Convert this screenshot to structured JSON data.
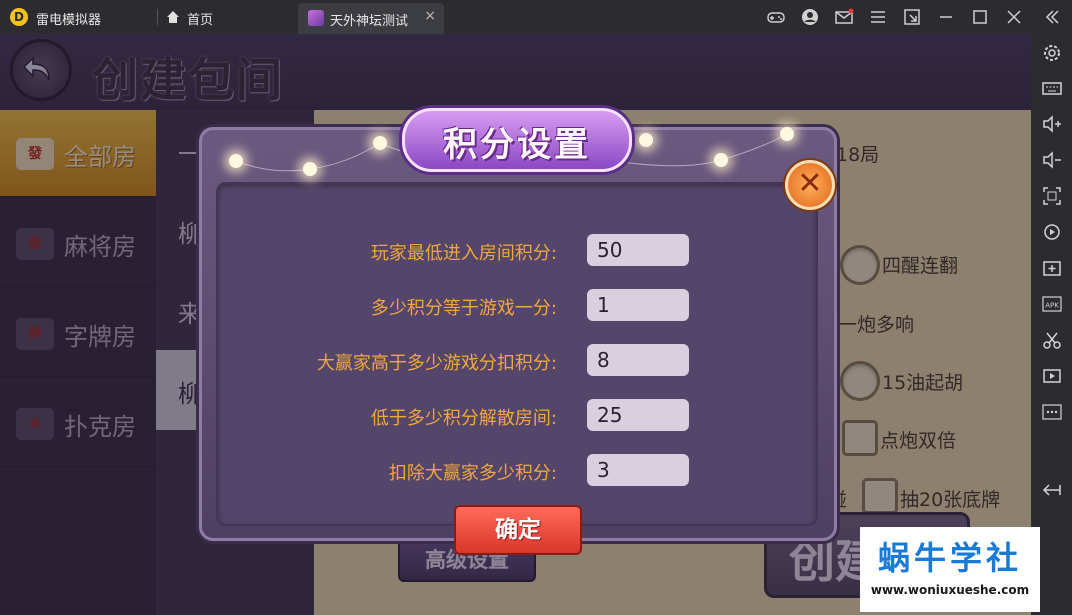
{
  "emulator": {
    "app_name": "雷电模拟器",
    "home_tab": "首页",
    "active_tab": "天外神坛测试",
    "tab_close": "×",
    "sidebar_apk_label": "APK"
  },
  "game": {
    "title": "创建包间",
    "nav": [
      {
        "label": "全部房",
        "icon": "發"
      },
      {
        "label": "麻将房",
        "icon": "發"
      },
      {
        "label": "字牌房",
        "icon": "牌"
      },
      {
        "label": "扑克房",
        "icon": "A"
      }
    ],
    "mid_items": [
      "一",
      "柳",
      "来",
      "柳"
    ],
    "panel": {
      "rounds": "18局",
      "options": [
        "四醒连翻",
        "一炮多响",
        "15油起胡",
        "点炮双倍",
        "碰",
        "抽20张底牌"
      ]
    },
    "advanced_button": "高级设置",
    "create_button": "创建"
  },
  "dialog": {
    "title": "积分设置",
    "close": "✕",
    "fields": [
      {
        "label": "玩家最低进入房间积分:",
        "value": "50"
      },
      {
        "label": "多少积分等于游戏一分:",
        "value": "1"
      },
      {
        "label": "大赢家高于多少游戏分扣积分:",
        "value": "8"
      },
      {
        "label": "低于多少积分解散房间:",
        "value": "25"
      },
      {
        "label": "扣除大赢家多少积分:",
        "value": "3"
      }
    ],
    "confirm": "确定"
  },
  "watermark": {
    "title": "蜗牛学社",
    "url": "www.woniuxueshe.com"
  }
}
